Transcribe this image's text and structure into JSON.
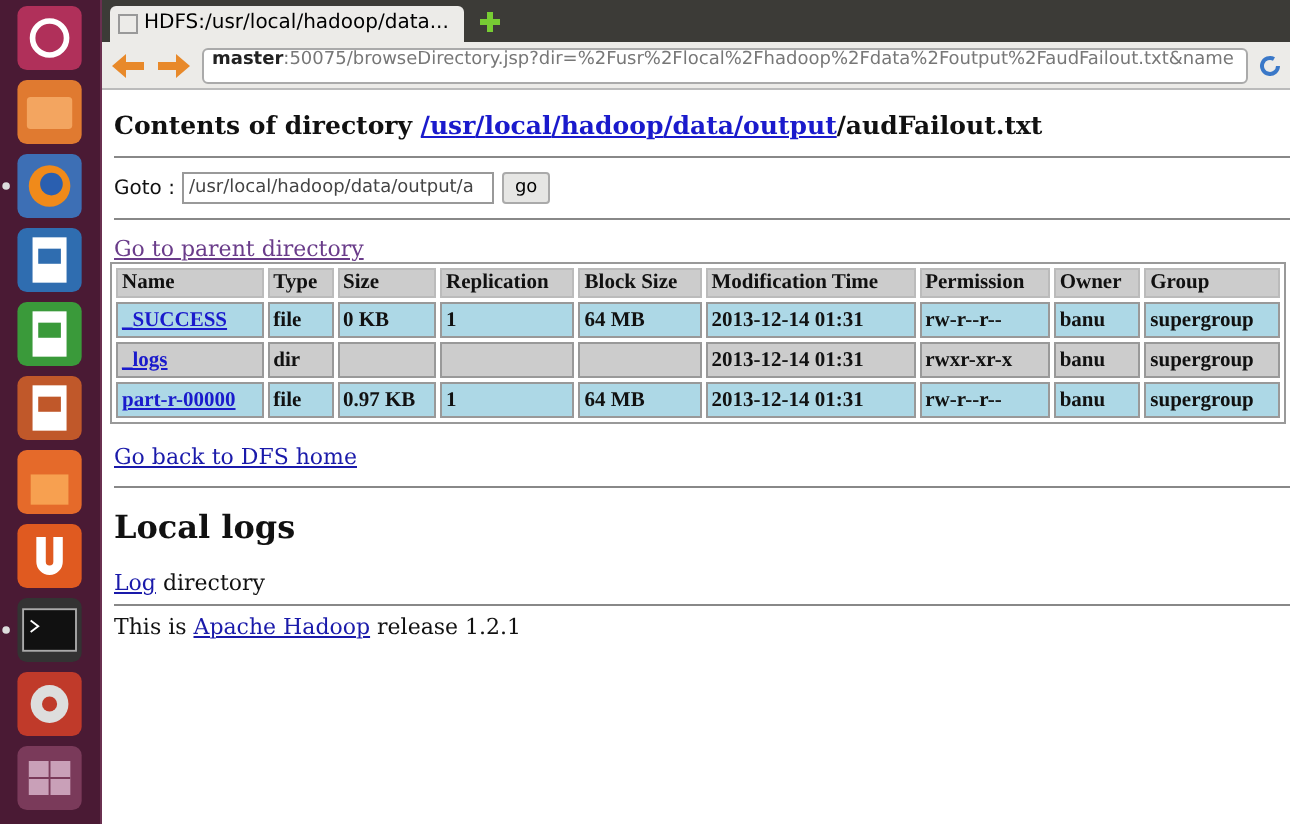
{
  "launcher": [
    {
      "kind": "dash",
      "running": false
    },
    {
      "kind": "folder",
      "running": false
    },
    {
      "kind": "browser",
      "running": true
    },
    {
      "kind": "writer",
      "running": false
    },
    {
      "kind": "calc",
      "running": false
    },
    {
      "kind": "impress",
      "running": false
    },
    {
      "kind": "store",
      "running": false
    },
    {
      "kind": "u",
      "running": false
    },
    {
      "kind": "terminal",
      "running": true
    },
    {
      "kind": "settings",
      "running": false
    },
    {
      "kind": "workspaces",
      "running": false
    }
  ],
  "browser": {
    "tab_title": "HDFS:/usr/local/hadoop/data...",
    "url_host": "master",
    "url_rest": ":50075/browseDirectory.jsp?dir=%2Fusr%2Flocal%2Fhadoop%2Fdata%2Foutput%2FaudFailout.txt&name"
  },
  "page": {
    "heading_prefix": "Contents of directory",
    "path_links": [
      "/usr",
      "/local",
      "/hadoop",
      "/data",
      "/output"
    ],
    "path_file": "/audFailout.txt",
    "goto": {
      "label": "Goto :",
      "value": "/usr/local/hadoop/data/output/a",
      "button": "go"
    },
    "parent_link": "Go to parent directory",
    "table": {
      "columns": [
        "Name",
        "Type",
        "Size",
        "Replication",
        "Block Size",
        "Modification Time",
        "Permission",
        "Owner",
        "Group"
      ],
      "rows": [
        [
          "_SUCCESS",
          "file",
          "0 KB",
          "1",
          "64 MB",
          "2013-12-14 01:31",
          "rw-r--r--",
          "banu",
          "supergroup"
        ],
        [
          "_logs",
          "dir",
          "",
          "",
          "",
          "2013-12-14 01:31",
          "rwxr-xr-x",
          "banu",
          "supergroup"
        ],
        [
          "part-r-00000",
          "file",
          "0.97 KB",
          "1",
          "64 MB",
          "2013-12-14 01:31",
          "rw-r--r--",
          "banu",
          "supergroup"
        ]
      ]
    },
    "home_link": "Go back to DFS home",
    "logs_heading": "Local logs",
    "log_link": "Log",
    "log_text": "directory",
    "footer_prefix": "This is",
    "footer_link": "Apache Hadoop",
    "footer_suffix": "release 1.2.1"
  }
}
